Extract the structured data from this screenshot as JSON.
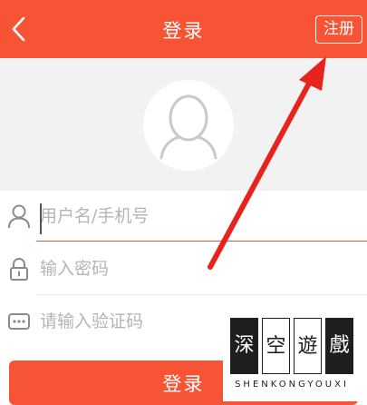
{
  "header": {
    "title": "登录",
    "register_label": "注册",
    "back_icon": "chevron-left-icon",
    "background": "#f75436"
  },
  "profile": {
    "avatar_icon": "default-avatar-icon"
  },
  "form": {
    "username": {
      "icon": "user-icon",
      "placeholder": "用户名/手机号",
      "value": ""
    },
    "password": {
      "icon": "lock-icon",
      "placeholder": "输入密码",
      "value": ""
    },
    "captcha": {
      "icon": "dots-icon",
      "placeholder": "请输入验证码",
      "value": ""
    }
  },
  "actions": {
    "login_label": "登录"
  },
  "watermark": {
    "chars": [
      "深",
      "空",
      "遊",
      "戲"
    ],
    "subtitle": "SHENKONGYOUXI"
  },
  "colors": {
    "accent": "#f75436",
    "annotation_arrow": "#e8231c",
    "avatar_bg": "#f2f2f2"
  }
}
